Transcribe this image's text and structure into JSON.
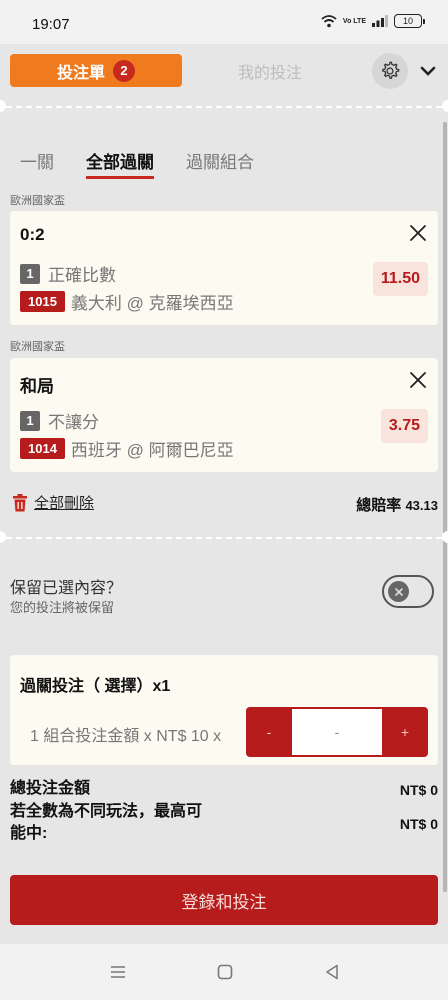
{
  "status_bar": {
    "time": "19:07",
    "volte_label": "Vo LTE",
    "battery_level": "10",
    "icons": [
      "wifi-icon",
      "volte-icon",
      "signal-icon",
      "battery-icon"
    ]
  },
  "header": {
    "betslip_label": "投注單",
    "betslip_count": "2",
    "mybets_label": "我的投注",
    "settings_icon": "gear-icon",
    "collapse_icon": "chevron-down-icon"
  },
  "mode_tabs": [
    {
      "label": "一關",
      "active": false
    },
    {
      "label": "全部過關",
      "active": true
    },
    {
      "label": "過關組合",
      "active": false
    }
  ],
  "bets": [
    {
      "league": "歐洲國家盃",
      "selection": "0:2",
      "leg_number": "1",
      "market": "正確比數",
      "match_id": "1015",
      "match": "義大利 @ 克羅埃西亞",
      "odds": "11.50"
    },
    {
      "league": "歐洲國家盃",
      "selection": "和局",
      "leg_number": "1",
      "market": "不讓分",
      "match_id": "1014",
      "match": "西班牙 @ 阿爾巴尼亞",
      "odds": "3.75"
    }
  ],
  "actions": {
    "delete_all_label": "全部刪除",
    "total_odds_label": "總賠率",
    "total_odds_value": "43.13"
  },
  "keep_selection": {
    "title": "保留已選內容？",
    "subtitle": "您的投注將被保留",
    "enabled": false
  },
  "parlay": {
    "title": "過關投注（ 選擇）x1",
    "stake_label": "1 組合投注金額 x NT$ 10 x",
    "minus_label": "-",
    "stake_value": "-",
    "plus_label": "+"
  },
  "summary": {
    "total_stake_label": "總投注金額",
    "total_stake_value": "NT$ 0",
    "max_win_label_line1": "若全數為不同玩法，最高可",
    "max_win_label_line2": "能中:",
    "max_win_value": "NT$ 0"
  },
  "submit_label": "登錄和投注",
  "colors": {
    "brand_orange": "#f07a1e",
    "brand_red": "#b71c1c",
    "card_bg": "#fdfaf1",
    "sheet_bg": "#e6e6e6"
  },
  "nav_bar": [
    "menu-icon",
    "home-icon",
    "back-icon"
  ]
}
